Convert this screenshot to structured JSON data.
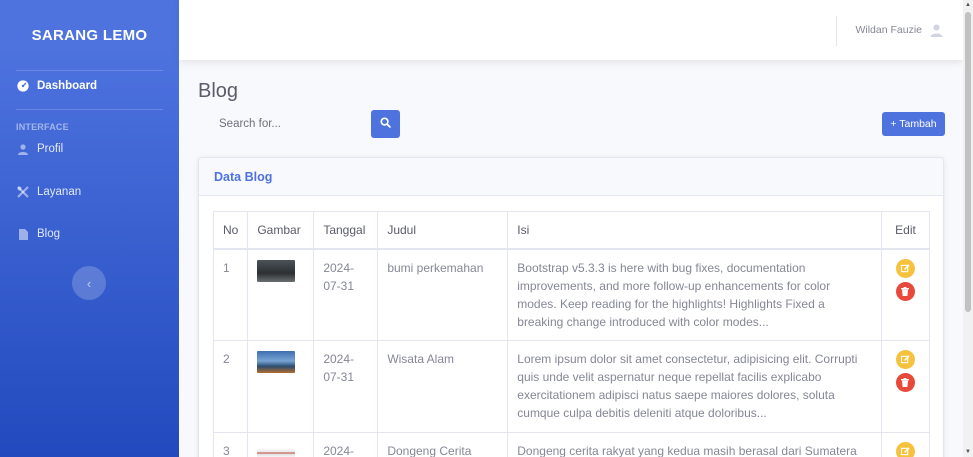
{
  "sidebar": {
    "brand": "SARANG LEMO",
    "items": [
      {
        "label": "Dashboard",
        "icon": "tachometer-icon",
        "active": true
      },
      {
        "label": "Profil",
        "icon": "user-icon"
      },
      {
        "label": "Layanan",
        "icon": "tools-icon"
      },
      {
        "label": "Blog",
        "icon": "file-icon"
      }
    ],
    "heading": "INTERFACE",
    "toggle_symbol": "‹"
  },
  "topbar": {
    "user_name": "Wildan Fauzie"
  },
  "page": {
    "title": "Blog",
    "search_placeholder": "Search for...",
    "add_button": "+ Tambah"
  },
  "card": {
    "title": "Data Blog"
  },
  "table": {
    "headers": [
      "No",
      "Gambar",
      "Tanggal",
      "Judul",
      "Isi",
      "Edit"
    ],
    "rows": [
      {
        "no": "1",
        "tanggal": "2024-07-31",
        "judul": "bumi perkemahan",
        "isi": "Bootstrap v5.3.3 is here with bug fixes, documentation improvements, and more follow-up enhancements for color modes. Keep reading for the highlights! Highlights Fixed a breaking change introduced with color modes..."
      },
      {
        "no": "2",
        "tanggal": "2024-07-31",
        "judul": "Wisata Alam",
        "isi": "Lorem ipsum dolor sit amet consectetur, adipisicing elit. Corrupti quis unde velit aspernatur neque repellat facilis explicabo exercitationem adipisci natus saepe maiores dolores, soluta cumque culpa debitis deleniti atque doloribus..."
      },
      {
        "no": "3",
        "tanggal": "2024-",
        "judul": "Dongeng Cerita",
        "isi": "Dongeng cerita rakyat yang kedua masih berasal dari Sumatera"
      }
    ]
  },
  "colors": {
    "primary": "#4e73df",
    "warning": "#f6c23e",
    "danger": "#e74a3b"
  }
}
